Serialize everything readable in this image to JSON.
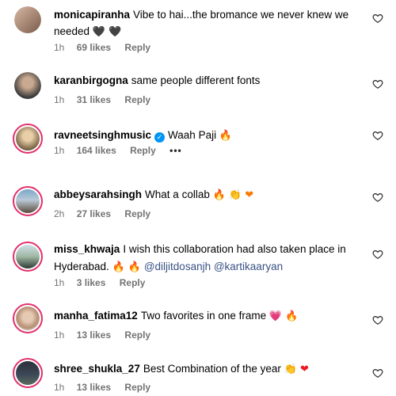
{
  "comments": [
    {
      "user": "monicapiranha",
      "text": "Vibe to hai...the bromance we never knew we needed",
      "emoji": "🖤 🖤",
      "time": "1h",
      "likes": "69 likes",
      "reply": "Reply"
    },
    {
      "user": "karanbirgogna",
      "text": "same people different fonts",
      "time": "1h",
      "likes": "31 likes",
      "reply": "Reply"
    },
    {
      "user": "ravneetsinghmusic",
      "text": "Waah Paji",
      "emoji": "🔥",
      "time": "1h",
      "likes": "164 likes",
      "reply": "Reply",
      "more": "•••"
    },
    {
      "user": "abbeysarahsingh",
      "text": "What a collab",
      "emoji": "🔥 👏 ❤",
      "time": "2h",
      "likes": "27 likes",
      "reply": "Reply"
    },
    {
      "user": "miss_khwaja",
      "text": "I wish this collaboration had also taken place in Hyderabad.",
      "emoji": "🔥 🔥",
      "mentions": "@diljitdosanjh @kartikaaryan",
      "time": "1h",
      "likes": "3 likes",
      "reply": "Reply"
    },
    {
      "user": "manha_fatima12",
      "text": "Two favorites in one frame",
      "emoji": "💗 🔥",
      "time": "1h",
      "likes": "13 likes",
      "reply": "Reply"
    },
    {
      "user": "shree_shukla_27",
      "text": "Best Combination of the year",
      "emoji": "👏 ❤",
      "time": "1h",
      "likes": "13 likes",
      "reply": "Reply"
    }
  ],
  "icons": {
    "like": "heart-outline-icon",
    "verified": "verified-badge-icon"
  }
}
